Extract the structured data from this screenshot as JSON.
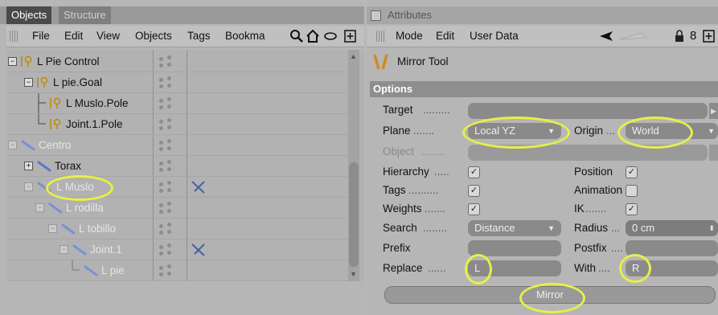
{
  "left": {
    "tabs": [
      "Objects",
      "Structure"
    ],
    "menu": [
      "File",
      "Edit",
      "View",
      "Objects",
      "Tags",
      "Bookma"
    ],
    "rows": [
      {
        "name": "L Pie Control",
        "dim": false
      },
      {
        "name": "L pie.Goal",
        "dim": false
      },
      {
        "name": "L Muslo.Pole",
        "dim": false
      },
      {
        "name": "Joint.1.Pole",
        "dim": false
      },
      {
        "name": "Centro",
        "dim": true
      },
      {
        "name": "Torax",
        "dim": false
      },
      {
        "name": "L Muslo",
        "dim": true
      },
      {
        "name": "L rodilla",
        "dim": true
      },
      {
        "name": "L tobillo",
        "dim": true
      },
      {
        "name": "Joint.1",
        "dim": true
      },
      {
        "name": "L pie",
        "dim": true
      }
    ]
  },
  "right": {
    "title": "Attributes",
    "menu": [
      "Mode",
      "Edit",
      "User Data"
    ],
    "tool_name": "Mirror Tool",
    "section": "Options",
    "labels": {
      "target": "Target",
      "plane": "Plane",
      "origin": "Origin",
      "object": "Object",
      "hierarchy": "Hierarchy",
      "position": "Position",
      "tags": "Tags",
      "animation": "Animation",
      "weights": "Weights",
      "ik": "IK",
      "search": "Search",
      "radius": "Radius",
      "prefix": "Prefix",
      "postfix": "Postfix",
      "replace": "Replace",
      "with": "With"
    },
    "values": {
      "plane": "Local YZ",
      "origin": "World",
      "search": "Distance",
      "radius": "0 cm",
      "replace": "L",
      "with": "R"
    },
    "mirror_button": "Mirror"
  }
}
